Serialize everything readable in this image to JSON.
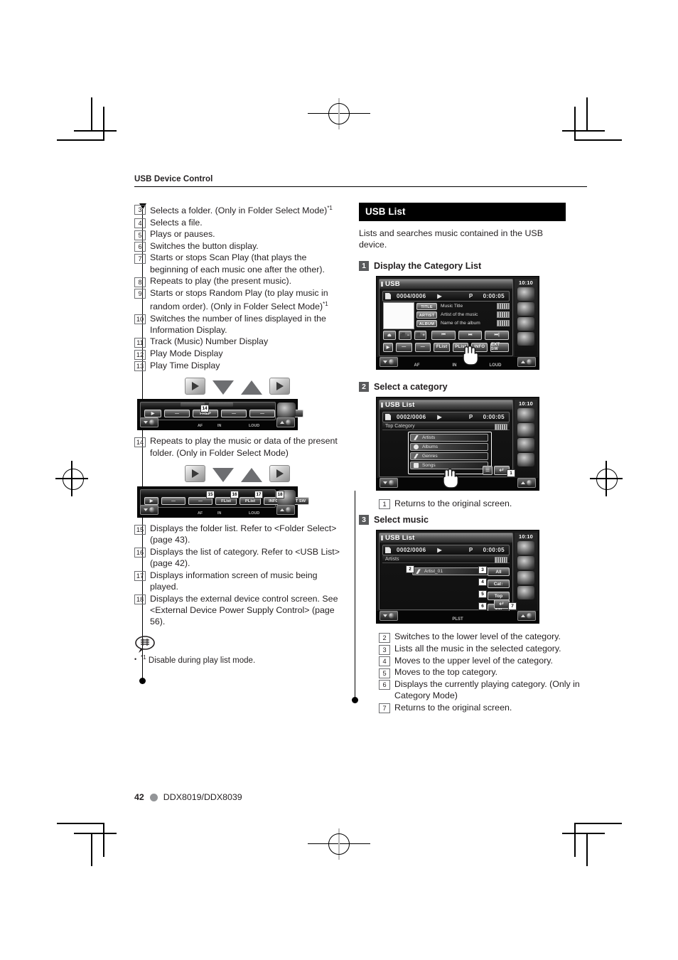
{
  "running_head": "USB Device Control",
  "footer": {
    "page_number": "42",
    "model": "DDX8019/DDX8039"
  },
  "left_column": {
    "items": [
      {
        "num": "3",
        "text": "Selects a folder. (Only in Folder Select Mode)",
        "footnote": "*1"
      },
      {
        "num": "4",
        "text": "Selects a file."
      },
      {
        "num": "5",
        "text": "Plays or pauses."
      },
      {
        "num": "6",
        "text": "Switches the button display."
      },
      {
        "num": "7",
        "text": "Starts or stops Scan Play (that plays the beginning of each music one after the other)."
      },
      {
        "num": "8",
        "text": "Repeats to play (the present music)."
      },
      {
        "num": "9",
        "text": "Starts or stops Random Play (to play music in random order). (Only in Folder Select Mode)",
        "footnote": "*1"
      },
      {
        "num": "10",
        "text": "Switches the number of lines displayed in the Information Display."
      },
      {
        "num": "11",
        "text": "Track (Music) Number Display"
      },
      {
        "num": "12",
        "text": "Play Mode Display"
      },
      {
        "num": "13",
        "text": "Play Time Display"
      }
    ],
    "items2": [
      {
        "num": "14",
        "text": "Repeats to play the music or data of the present folder. (Only in Folder Select Mode)"
      }
    ],
    "items3": [
      {
        "num": "15",
        "text": "Displays the folder list. Refer to <Folder Select> (page 43)."
      },
      {
        "num": "16",
        "text": "Displays the list of category. Refer to <USB List> (page 42)."
      },
      {
        "num": "17",
        "text": "Displays information screen of music being played."
      },
      {
        "num": "18",
        "text": "Displays the external device control screen. See <External Device Power Supply Control> (page 56)."
      }
    ],
    "note": {
      "marker": "*1",
      "text": "Disable during play list mode."
    },
    "strip1": {
      "callout": "14",
      "buttons": [
        "▶",
        "—",
        "FREP",
        "—",
        "—",
        "—",
        "—"
      ],
      "labels": [
        "AF",
        "IN",
        "LOUD"
      ]
    },
    "strip2": {
      "callouts": [
        "15",
        "16",
        "17",
        "18"
      ],
      "buttons": [
        "▶",
        "—",
        "—",
        "FList",
        "PList",
        "INFO",
        "EXT SW"
      ],
      "labels": [
        "AF",
        "IN",
        "LOUD"
      ]
    }
  },
  "right_column": {
    "section_title": "USB List",
    "intro": "Lists and searches music contained in the USB device.",
    "steps": [
      {
        "num": "1",
        "label": "Display the Category List"
      },
      {
        "num": "2",
        "label": "Select a category"
      },
      {
        "num": "3",
        "label": "Select music"
      }
    ],
    "after_step2": [
      {
        "num": "1",
        "text": "Returns to the original screen."
      }
    ],
    "after_step3": [
      {
        "num": "2",
        "text": "Switches to the lower level of the category."
      },
      {
        "num": "3",
        "text": "Lists all the music in the selected category."
      },
      {
        "num": "4",
        "text": "Moves to the upper level of the category."
      },
      {
        "num": "5",
        "text": "Moves to the top category."
      },
      {
        "num": "6",
        "text": "Displays the currently playing category. (Only in Category Mode)"
      },
      {
        "num": "7",
        "text": "Returns to the original screen."
      }
    ],
    "screen1": {
      "title": "USB",
      "clock": "10:10",
      "track": "0004/0006",
      "play_icon": "▶",
      "mode": "P",
      "time": "0:00:05",
      "tags": [
        {
          "label": "TITLE",
          "value": "Music Title"
        },
        {
          "label": "ARTIST",
          "value": "Artist of the music"
        },
        {
          "label": "ALBUM",
          "value": "Name of the album"
        }
      ],
      "transport": [
        "⏏",
        "⬛ −",
        "⬛ +",
        "⏮",
        "⏭",
        "⏭|"
      ],
      "functions": [
        "▶",
        "—",
        "—",
        "FList",
        "PList",
        "INFO",
        "EXT SW"
      ],
      "bottom_labels": [
        "AF",
        "IN",
        "LOUD"
      ]
    },
    "screen2": {
      "title": "USB List",
      "clock": "10:10",
      "track": "0002/0006",
      "play_icon": "▶",
      "mode": "P",
      "time": "0:00:05",
      "breadcrumb": "Top Category",
      "categories": [
        "Artists",
        "Albums",
        "Genres",
        "Songs"
      ],
      "callout_return": "1"
    },
    "screen3": {
      "title": "USB List",
      "clock": "10:10",
      "track": "0002/0006",
      "play_icon": "▶",
      "mode": "P",
      "time": "0:00:05",
      "breadcrumb": "Artists",
      "entry": "Artist_01",
      "entry_callout": "2",
      "side_buttons": [
        {
          "callout": "3",
          "label": "All"
        },
        {
          "callout": "4",
          "label": "Cat↑"
        },
        {
          "callout": "5",
          "label": "Top"
        },
        {
          "callout": "6",
          "label": "Cur"
        }
      ],
      "return_callout": "7",
      "bottom_label": "PLST"
    }
  }
}
